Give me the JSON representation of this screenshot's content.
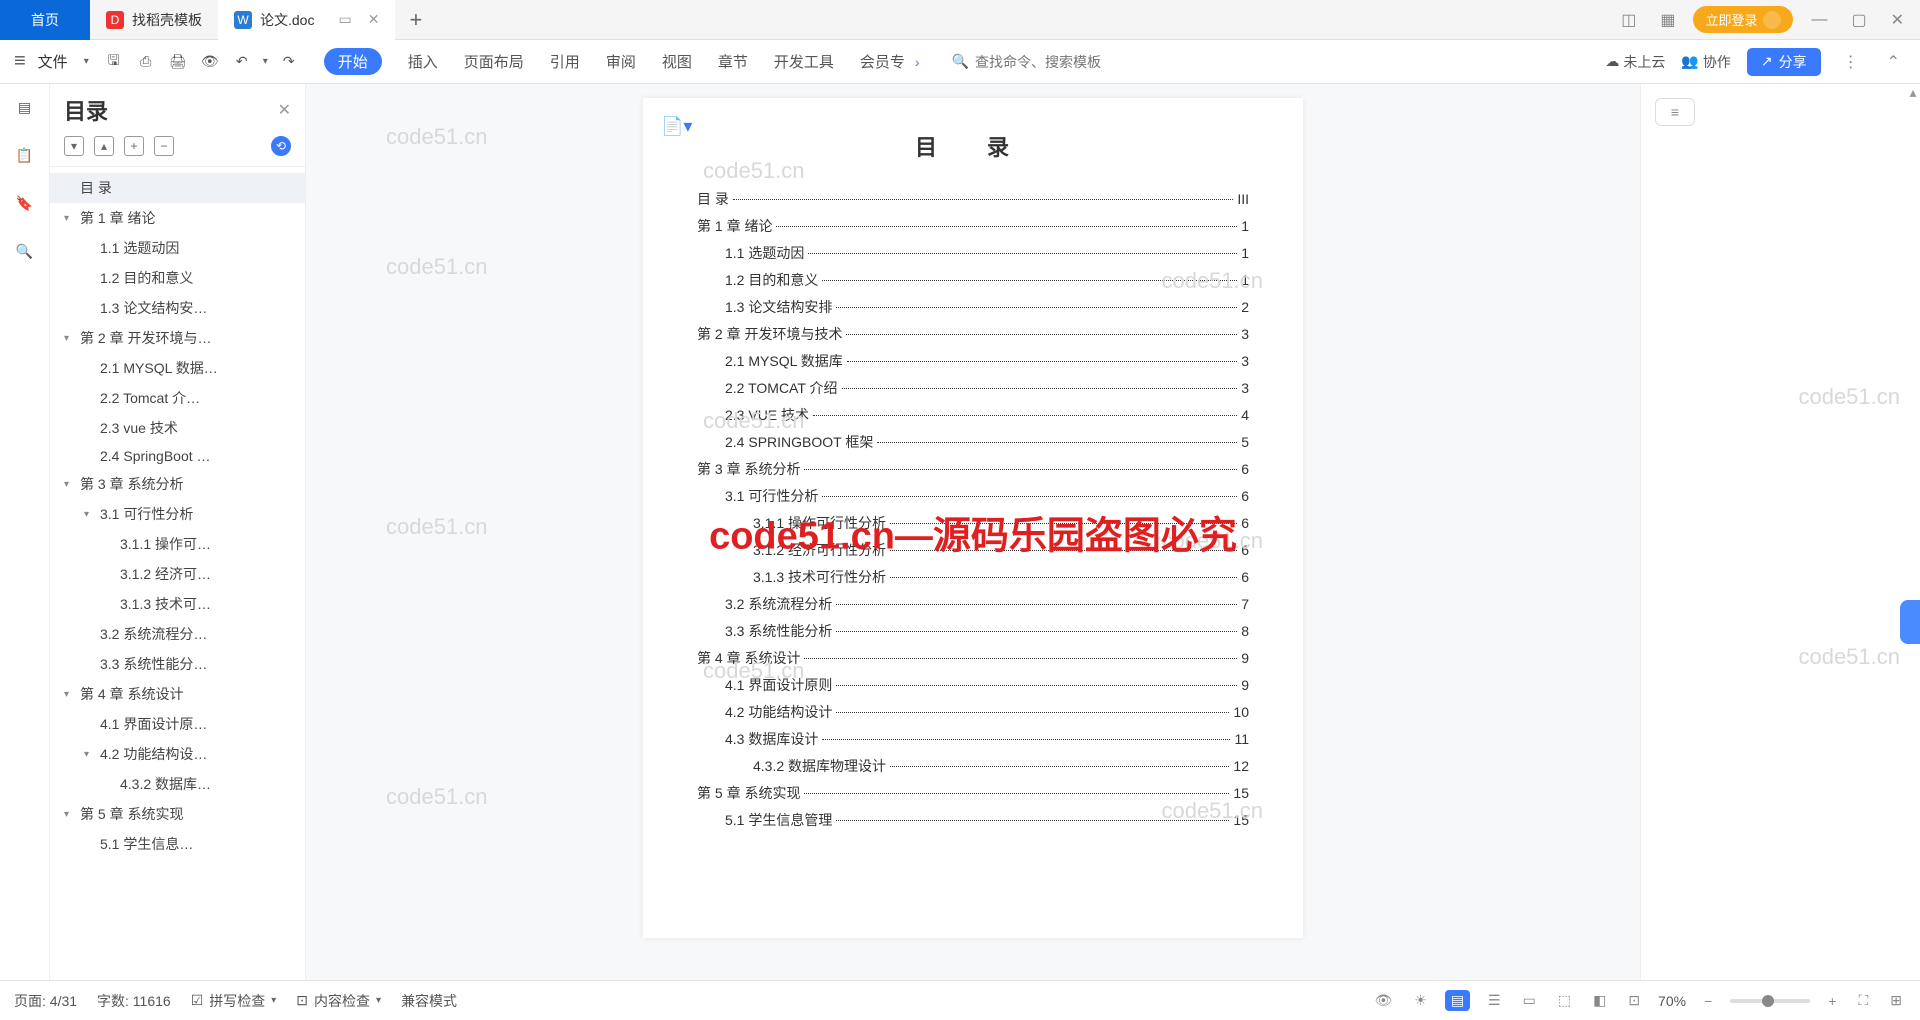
{
  "tabs": [
    {
      "label": "首页",
      "icon": "home"
    },
    {
      "label": "找稻壳模板",
      "icon": "dk"
    },
    {
      "label": "论文.doc",
      "icon": "doc"
    }
  ],
  "login": "立即登录",
  "file_label": "文件",
  "ribbon": [
    "开始",
    "插入",
    "页面布局",
    "引用",
    "审阅",
    "视图",
    "章节",
    "开发工具",
    "会员专"
  ],
  "search_placeholder": "查找命令、搜索模板",
  "cloud": "未上云",
  "coop": "协作",
  "share": "分享",
  "nav_title": "目录",
  "nav": [
    {
      "i": 0,
      "t": "",
      "l": "目  录",
      "sel": true
    },
    {
      "i": 0,
      "t": "v",
      "l": "第 1 章  绪论"
    },
    {
      "i": 1,
      "t": "",
      "l": "1.1 选题动因"
    },
    {
      "i": 1,
      "t": "",
      "l": "1.2 目的和意义"
    },
    {
      "i": 1,
      "t": "",
      "l": "1.3 论文结构安…"
    },
    {
      "i": 0,
      "t": "v",
      "l": "第 2 章  开发环境与…"
    },
    {
      "i": 1,
      "t": "",
      "l": "2.1 MYSQL 数据…"
    },
    {
      "i": 1,
      "t": "",
      "l": "2.2 Tomcat  介…"
    },
    {
      "i": 1,
      "t": "",
      "l": "2.3 vue 技术"
    },
    {
      "i": 1,
      "t": "",
      "l": "2.4 SpringBoot …"
    },
    {
      "i": 0,
      "t": "v",
      "l": "第 3 章  系统分析"
    },
    {
      "i": 1,
      "t": "v",
      "l": "3.1 可行性分析"
    },
    {
      "i": 2,
      "t": "",
      "l": "3.1.1 操作可…"
    },
    {
      "i": 2,
      "t": "",
      "l": "3.1.2 经济可…"
    },
    {
      "i": 2,
      "t": "",
      "l": "3.1.3 技术可…"
    },
    {
      "i": 1,
      "t": "",
      "l": "3.2 系统流程分…"
    },
    {
      "i": 1,
      "t": "",
      "l": "3.3 系统性能分…"
    },
    {
      "i": 0,
      "t": "v",
      "l": "第 4 章  系统设计"
    },
    {
      "i": 1,
      "t": "",
      "l": "4.1 界面设计原…"
    },
    {
      "i": 1,
      "t": "v",
      "l": "4.2 功能结构设…"
    },
    {
      "i": 2,
      "t": "",
      "l": "4.3.2  数据库…"
    },
    {
      "i": 0,
      "t": "v",
      "l": "第 5 章  系统实现"
    },
    {
      "i": 1,
      "t": "",
      "l": "5.1 学生信息…"
    }
  ],
  "doc_title": "目 录",
  "toc": [
    {
      "i": 0,
      "t": "目  录",
      "p": "III"
    },
    {
      "i": 0,
      "t": "第 1 章  绪论",
      "p": "1"
    },
    {
      "i": 1,
      "t": "1.1 选题动因",
      "p": "1"
    },
    {
      "i": 1,
      "t": "1.2 目的和意义",
      "p": "1"
    },
    {
      "i": 1,
      "t": "1.3 论文结构安排",
      "p": "2"
    },
    {
      "i": 0,
      "t": "第 2 章  开发环境与技术",
      "p": "3"
    },
    {
      "i": 1,
      "t": "2.1 MYSQL 数据库",
      "p": "3"
    },
    {
      "i": 1,
      "t": "2.2 TOMCAT 介绍",
      "p": "3"
    },
    {
      "i": 1,
      "t": "2.3 VUE 技术",
      "p": "4"
    },
    {
      "i": 1,
      "t": "2.4 SPRINGBOOT 框架",
      "p": "5"
    },
    {
      "i": 0,
      "t": "第 3 章  系统分析",
      "p": "6"
    },
    {
      "i": 1,
      "t": "3.1 可行性分析",
      "p": "6"
    },
    {
      "i": 2,
      "t": "3.1.1 操作可行性分析",
      "p": "6"
    },
    {
      "i": 2,
      "t": "3.1.2 经济可行性分析",
      "p": "6"
    },
    {
      "i": 2,
      "t": "3.1.3 技术可行性分析",
      "p": "6"
    },
    {
      "i": 1,
      "t": "3.2 系统流程分析",
      "p": "7"
    },
    {
      "i": 1,
      "t": "3.3 系统性能分析",
      "p": "8"
    },
    {
      "i": 0,
      "t": "第 4 章  系统设计",
      "p": "9"
    },
    {
      "i": 1,
      "t": "4.1 界面设计原则",
      "p": "9"
    },
    {
      "i": 1,
      "t": "4.2 功能结构设计",
      "p": "10"
    },
    {
      "i": 1,
      "t": "4.3 数据库设计",
      "p": "11"
    },
    {
      "i": 2,
      "t": "4.3.2  数据库物理设计",
      "p": "12"
    },
    {
      "i": 0,
      "t": "第 5 章  系统实现",
      "p": "15"
    },
    {
      "i": 1,
      "t": "5.1 学生信息管理",
      "p": "15"
    }
  ],
  "watermark_small": "code51.cn",
  "watermark_big": "code51.cn—源码乐园盗图必究",
  "status": {
    "page": "页面: 4/31",
    "words": "字数: 11616",
    "spell": "拼写检查",
    "content": "内容检查",
    "compat": "兼容模式",
    "zoom": "70%"
  }
}
